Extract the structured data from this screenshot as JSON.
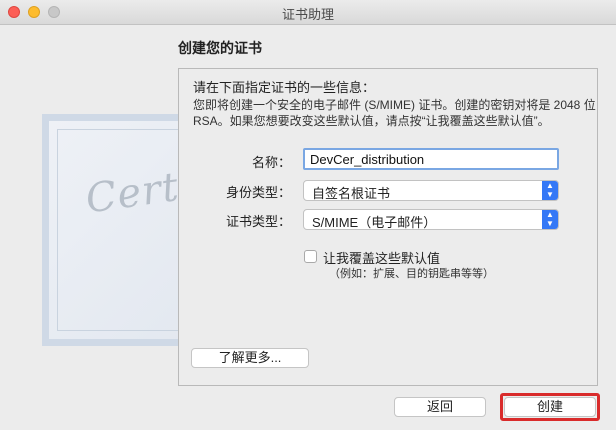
{
  "window": {
    "title": "证书助理"
  },
  "header": {
    "title": "创建您的证书"
  },
  "panel": {
    "intro": "请在下面指定证书的一些信息：",
    "desc_line1": "您即将创建一个安全的电子邮件 (S/MIME) 证书。创建的密钥对将是 2048 位",
    "desc_line2": "RSA。如果您想要改变这些默认值，请点按“让我覆盖这些默认值”。"
  },
  "form": {
    "name_label": "名称：",
    "name_value": "DevCer_distribution",
    "identity_label": "身份类型：",
    "identity_value": "自签名根证书",
    "cert_label": "证书类型：",
    "cert_value": "S/MIME（电子邮件）",
    "override_label": "让我覆盖这些默认值",
    "override_sub": "（例如：扩展、目的钥匙串等等）"
  },
  "buttons": {
    "learn_more": "了解更多...",
    "back": "返回",
    "create": "创建"
  },
  "decoration": {
    "cert_text": "Certificate"
  },
  "colors": {
    "accent": "#3478f6",
    "highlight": "#d92b2b"
  }
}
